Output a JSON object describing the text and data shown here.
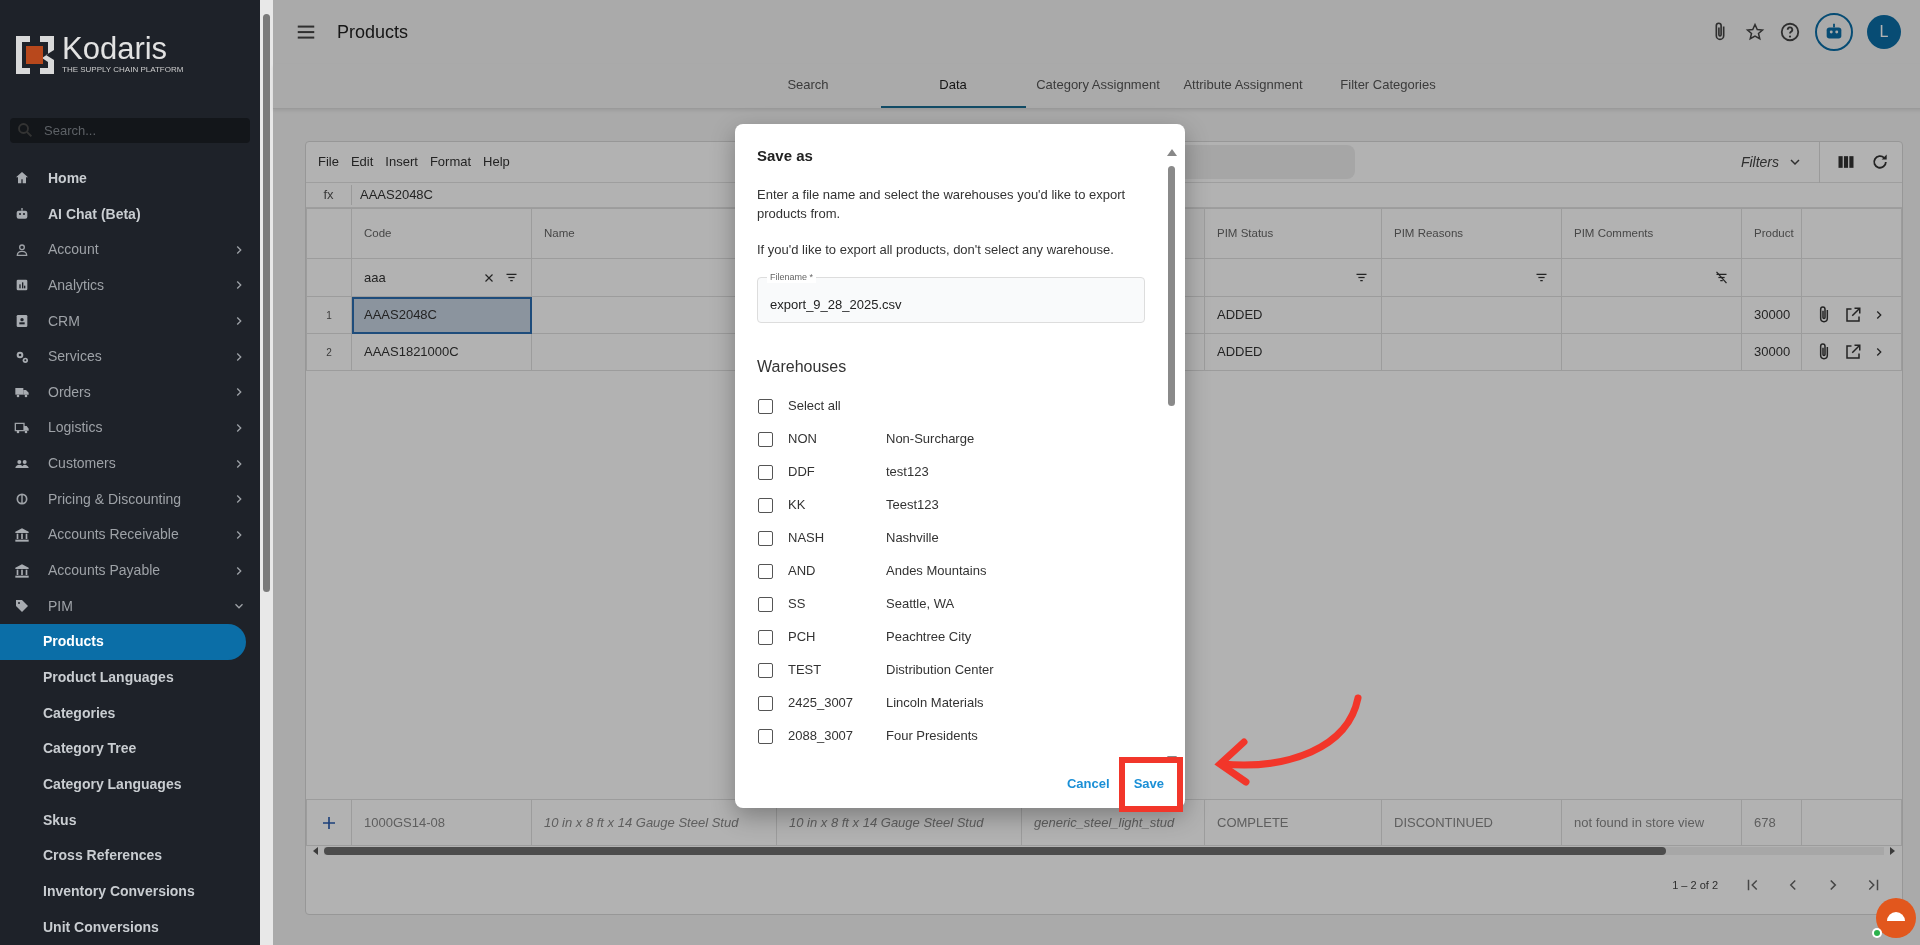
{
  "sidebar": {
    "logo": {
      "name": "Kodaris",
      "tagline": "THE SUPPLY CHAIN PLATFORM"
    },
    "search": {
      "placeholder": "Search..."
    },
    "items": [
      {
        "label": "Home",
        "kind": "link"
      },
      {
        "label": "AI Chat (Beta)",
        "kind": "link"
      },
      {
        "label": "Account",
        "kind": "group",
        "expanded": false
      },
      {
        "label": "Analytics",
        "kind": "group",
        "expanded": false
      },
      {
        "label": "CRM",
        "kind": "group",
        "expanded": false
      },
      {
        "label": "Services",
        "kind": "group",
        "expanded": false
      },
      {
        "label": "Orders",
        "kind": "group",
        "expanded": false
      },
      {
        "label": "Logistics",
        "kind": "group",
        "expanded": false
      },
      {
        "label": "Customers",
        "kind": "group",
        "expanded": false
      },
      {
        "label": "Pricing & Discounting",
        "kind": "group",
        "expanded": false
      },
      {
        "label": "Accounts Receivable",
        "kind": "group",
        "expanded": false
      },
      {
        "label": "Accounts Payable",
        "kind": "group",
        "expanded": false
      },
      {
        "label": "PIM",
        "kind": "group",
        "expanded": true,
        "children": [
          {
            "label": "Products",
            "selected": true
          },
          {
            "label": "Product Languages",
            "selected": false
          },
          {
            "label": "Categories",
            "selected": false
          },
          {
            "label": "Category Tree",
            "selected": false
          },
          {
            "label": "Category Languages",
            "selected": false
          },
          {
            "label": "Skus",
            "selected": false
          },
          {
            "label": "Cross References",
            "selected": false
          },
          {
            "label": "Inventory Conversions",
            "selected": false
          },
          {
            "label": "Unit Conversions",
            "selected": false
          }
        ]
      }
    ]
  },
  "header": {
    "title": "Products",
    "avatar": "L"
  },
  "tabs": [
    {
      "label": "Search",
      "selected": false
    },
    {
      "label": "Data",
      "selected": true
    },
    {
      "label": "Category Assignment",
      "selected": false
    },
    {
      "label": "Attribute Assignment",
      "selected": false
    },
    {
      "label": "Filter Categories",
      "selected": false
    }
  ],
  "sheet": {
    "menu": [
      "File",
      "Edit",
      "Insert",
      "Format",
      "Help"
    ],
    "filters": "Filters",
    "formula": {
      "label": "fx",
      "value": "AAAS2048C"
    },
    "columns": [
      {
        "label": "Code",
        "filter_enabled": true,
        "filter_value": "aaa"
      },
      {
        "label": "Name"
      },
      {
        "label": "PIM Status",
        "filter_enabled": true
      },
      {
        "label": "PIM Reasons",
        "filter_enabled": true
      },
      {
        "label": "PIM Comments",
        "filter_enabled": false
      },
      {
        "label": "Product"
      }
    ],
    "rows": [
      {
        "number": "1",
        "selected": true,
        "code": "AAAS2048C",
        "pim_status": "ADDED",
        "product": "30000"
      },
      {
        "number": "2",
        "selected": false,
        "code": "AAAS1821000C",
        "pim_status": "ADDED",
        "product": "30000"
      }
    ],
    "new_row": {
      "code": "1000GS14-08",
      "name": "10 in x 8 ft x 14 Gauge Steel Stud",
      "column_3": "10 in x 8 ft x 14 Gauge Steel Stud",
      "column_4": "generic_steel_light_stud",
      "pim_status": "COMPLETE",
      "pim_reasons": "DISCONTINUED",
      "pim_comments": "not found in store view",
      "product": "678"
    },
    "pagination": "1 – 2 of 2"
  },
  "dialog": {
    "title": "Save as",
    "paragraphs": [
      "Enter a file name and select the warehouses you'd like to export products from.",
      "If you'd like to export all products, don't select any warehouse."
    ],
    "field": {
      "label": "Filename *",
      "value": "export_9_28_2025.csv"
    },
    "section": "Warehouses",
    "select_all": {
      "label": "Select all",
      "checked": false
    },
    "warehouses": [
      {
        "code": "NON",
        "name": "Non-Surcharge",
        "checked": false
      },
      {
        "code": "DDF",
        "name": "test123",
        "checked": false
      },
      {
        "code": "KK",
        "name": "Teest123",
        "checked": false
      },
      {
        "code": "NASH",
        "name": "Nashville",
        "checked": false
      },
      {
        "code": "AND",
        "name": "Andes Mountains",
        "checked": false
      },
      {
        "code": "SS",
        "name": "Seattle, WA",
        "checked": false
      },
      {
        "code": "PCH",
        "name": "Peachtree City",
        "checked": false
      },
      {
        "code": "TEST",
        "name": "Distribution Center",
        "checked": false
      },
      {
        "code": "2425_3007",
        "name": "Lincoln Materials",
        "checked": false
      },
      {
        "code": "2088_3007",
        "name": "Four Presidents",
        "checked": false
      }
    ],
    "buttons": {
      "cancel": "Cancel",
      "save": "Save"
    }
  }
}
